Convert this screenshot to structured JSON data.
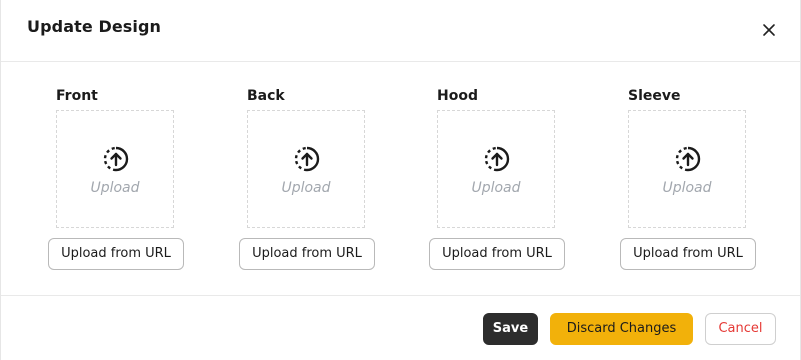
{
  "dialog": {
    "title": "Update Design",
    "close_icon": "close-icon"
  },
  "slots": [
    {
      "label": "Front",
      "upload_text": "Upload",
      "url_button": "Upload from URL"
    },
    {
      "label": "Back",
      "upload_text": "Upload",
      "url_button": "Upload from URL"
    },
    {
      "label": "Hood",
      "upload_text": "Upload",
      "url_button": "Upload from URL"
    },
    {
      "label": "Sleeve",
      "upload_text": "Upload",
      "url_button": "Upload from URL"
    }
  ],
  "upload_icon": "upload-circle-arrow-icon",
  "footer": {
    "save_label": "Save",
    "discard_label": "Discard Changes",
    "cancel_label": "Cancel"
  },
  "colors": {
    "save_bg": "#2d2d2d",
    "discard_bg": "#f2b10a",
    "cancel_text": "#e53935",
    "upload_placeholder_text": "#a2a7ae"
  }
}
